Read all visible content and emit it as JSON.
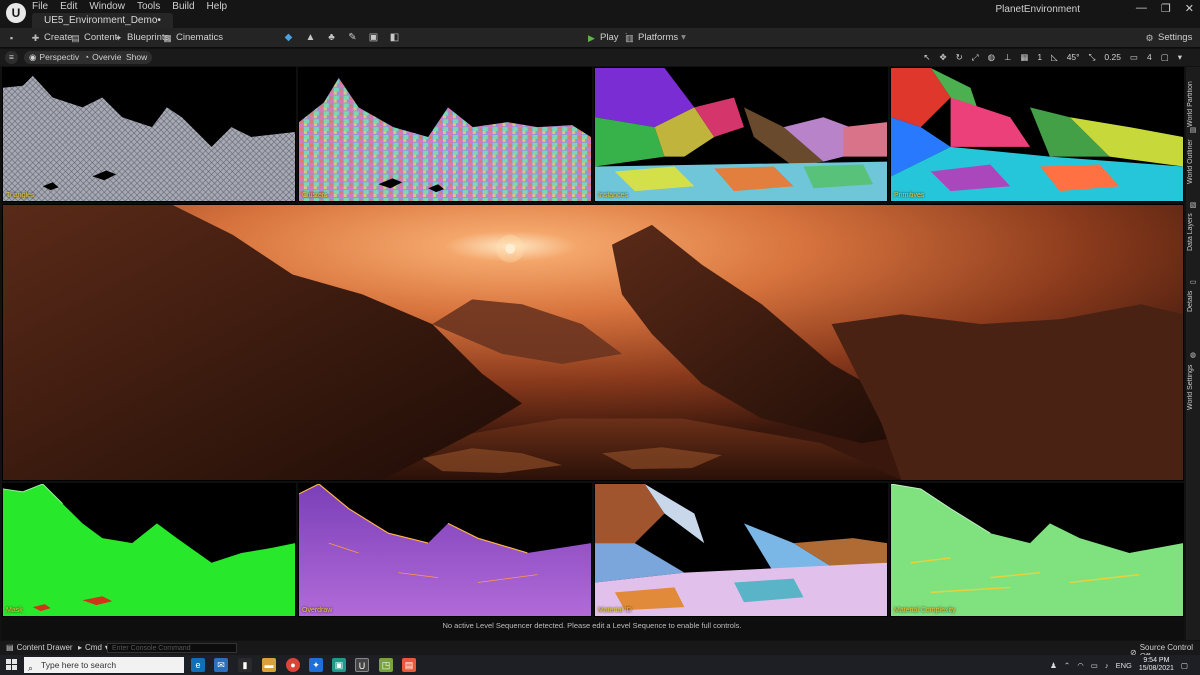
{
  "titlebar": {
    "logo": "ue-logo-icon",
    "menu": [
      "File",
      "Edit",
      "Window",
      "Tools",
      "Build",
      "Help"
    ],
    "tab": "UE5_Environment_Demo•",
    "project": "PlanetEnvironment",
    "controls": [
      "—",
      "❐",
      "✕"
    ]
  },
  "toolbar": {
    "create": "Create",
    "content": "Content",
    "blueprints": "Blueprints",
    "cinematics": "Cinematics",
    "play": "Play",
    "platforms": "Platforms",
    "settings": "Settings"
  },
  "viewport_toolbar": {
    "perspective": "Perspective",
    "overview": "Overview",
    "show": "Show",
    "grid_snap": "1",
    "angle_snap": "45°",
    "scale_snap": "0.25",
    "camera_speed": "4"
  },
  "panels": {
    "top": [
      "Triangles",
      "Clusters",
      "Instances",
      "Primitives"
    ],
    "bottom": [
      "Mask",
      "Overdraw",
      "Material ID",
      "Material Complexity"
    ],
    "main_scene": "Planet desert scene"
  },
  "side_tabs": [
    "World Partition",
    "World Outliner",
    "Data Layers",
    "Details",
    "World Settings"
  ],
  "status": {
    "message": "No active Level Sequencer detected. Please edit a Level Sequence to enable full controls.",
    "content_drawer": "Content Drawer",
    "cmd": "Cmd",
    "console_placeholder": "Enter Console Command",
    "source_control": "Source Control Off"
  },
  "taskbar": {
    "search_placeholder": "Type here to search",
    "lang": "ENG",
    "time": "9:54 PM",
    "date": "15/08/2021"
  },
  "colors": {
    "ue_dark": "#151515",
    "toolbar": "#242424",
    "play_green": "#5bb54a",
    "label_yellow": "#e8c53a",
    "sky_orange": "#d8743e"
  }
}
